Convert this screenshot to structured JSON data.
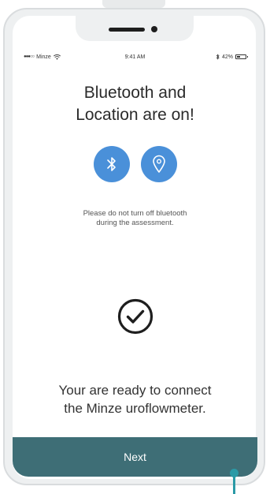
{
  "status_bar": {
    "signal": "●●●○○",
    "carrier": "Minze",
    "wifi_icon": "wifi-icon",
    "time": "9:41 AM",
    "bluetooth_icon": "bluetooth-icon",
    "battery": "42%",
    "battery_level": 0.42
  },
  "screen": {
    "title": "Bluetooth and\nLocation are on!",
    "icons": [
      "bluetooth-icon",
      "location-pin-icon"
    ],
    "notice": "Please do not turn off bluetooth\nduring the assessment.",
    "check_icon": "check-circle-icon",
    "ready_text": "Your are ready to connect\nthe Minze uroflowmeter."
  },
  "next_button": {
    "label": "Next"
  },
  "colors": {
    "accent_blue": "#4a90d9",
    "button_teal": "#3e6e76",
    "tap_indicator": "#2b9aa6"
  }
}
